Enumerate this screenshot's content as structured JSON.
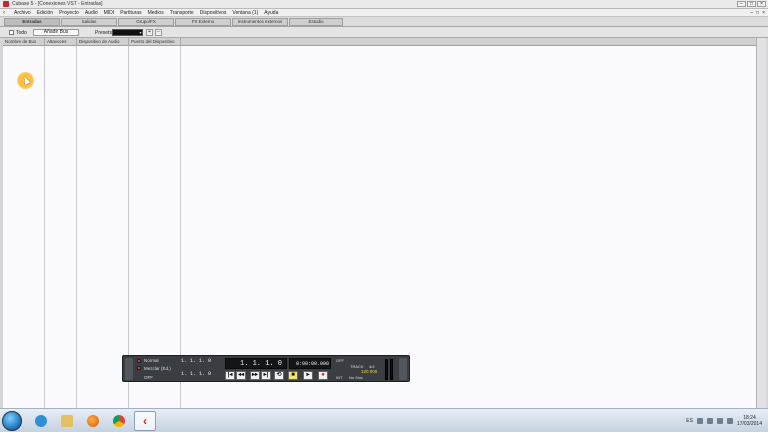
{
  "window": {
    "title": "Cubase 5 - [Conexiones VST - Entradas]",
    "controls": [
      "–",
      "□",
      "×"
    ]
  },
  "menu": {
    "items": [
      "Archivo",
      "Edición",
      "Proyecto",
      "Audio",
      "MIDI",
      "Partituras",
      "Medios",
      "Transporte",
      "Dispositivos",
      "Ventana (1)",
      "Ayuda"
    ],
    "mdi_controls": [
      "–",
      "□",
      "×"
    ]
  },
  "tabs": [
    "Entradas",
    "Salidas",
    "Grupo/FX",
    "FX Externo",
    "Instrumentos externos",
    "Estudio"
  ],
  "toolbar": {
    "all_label": "Todo",
    "add_bus_label": "Añadir Bus",
    "presets_label": "Presets"
  },
  "columns": [
    "Nombre de Bus",
    "Altavoces",
    "Dispositivo de Audio",
    "Puerto del Dispositivo"
  ],
  "transport": {
    "mode_top": "Normal",
    "mode_bottom": "Mezclar (Ed.)",
    "off_label": "OFF",
    "left_locator": "1. 1. 1.   0",
    "right_locator": "1. 1. 1.   0",
    "primary_time": "1. 1. 1.   0",
    "secondary_time": "0:00:00.000",
    "click_label": "OFF",
    "tempo_label": "TRACK",
    "signature": "4/4",
    "tempo_value": "120.000",
    "sync_label": "INT",
    "sync_mode": "No Sinc"
  },
  "taskbar": {
    "language": "ES",
    "time": "18:24",
    "date": "17/03/2014"
  }
}
